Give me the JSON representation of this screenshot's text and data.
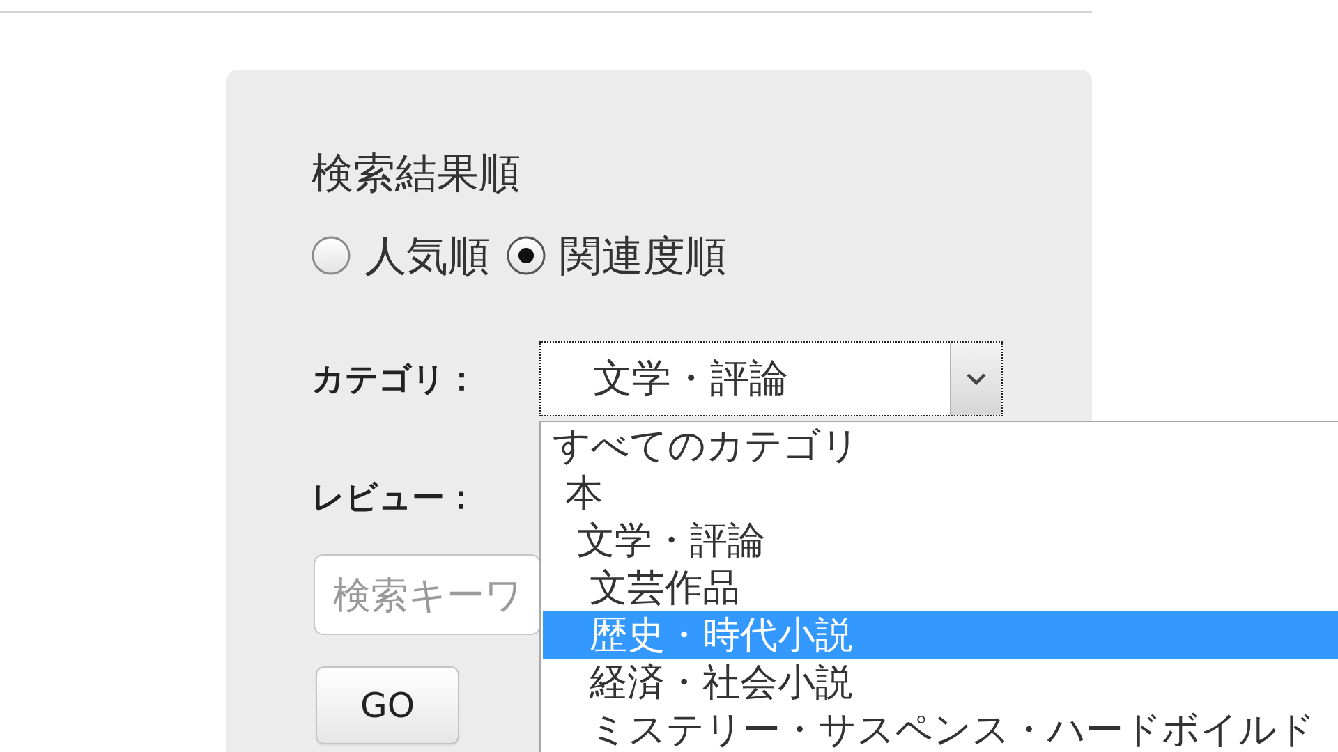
{
  "sort_panel": {
    "title": "検索結果順",
    "options": [
      {
        "label": "人気順",
        "selected": false
      },
      {
        "label": "関連度順",
        "selected": true
      }
    ]
  },
  "category": {
    "label": "カテゴリ：",
    "value": "文学・評論",
    "expanded": true,
    "options": [
      {
        "label": "すべてのカテゴリ",
        "selected": false,
        "children": [
          {
            "label": "本",
            "selected": false,
            "children": [
              {
                "label": "文学・評論",
                "selected": false,
                "children": [
                  {
                    "label": "文芸作品",
                    "selected": false
                  },
                  {
                    "label": "歴史・時代小説",
                    "selected": true
                  },
                  {
                    "label": "経済・社会小説",
                    "selected": false
                  },
                  {
                    "label": "ミステリー・サスペンス・ハードボイルド",
                    "selected": false
                  }
                ]
              }
            ]
          }
        ]
      }
    ]
  },
  "review": {
    "label": "レビュー："
  },
  "search": {
    "placeholder": "検索キーワ"
  },
  "go_button": {
    "label": "GO"
  }
}
